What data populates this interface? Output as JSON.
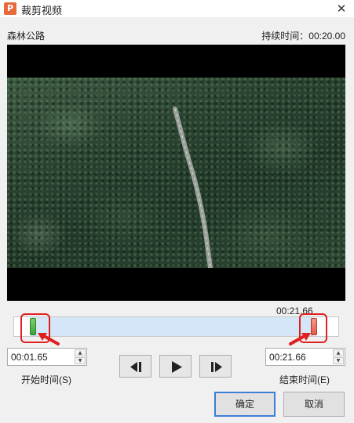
{
  "window": {
    "title": "裁剪视频",
    "app_icon_glyph": "P",
    "close_glyph": "✕"
  },
  "video": {
    "name": "森林公路",
    "duration_label": "持续时间：00:20.00"
  },
  "timeline": {
    "end_marker_time": "00:21.66",
    "start_handle_position": 0.06,
    "end_handle_position": 0.92
  },
  "start_time": {
    "value": "00:01.65",
    "label": "开始时间(S)"
  },
  "end_time": {
    "value": "00:21.66",
    "label": "结束时间(E)"
  },
  "spinner": {
    "up_glyph": "▲",
    "down_glyph": "▼"
  },
  "controls": {
    "prev_frame_icon": "step-back-icon",
    "play_icon": "play-icon",
    "next_frame_icon": "step-forward-icon"
  },
  "buttons": {
    "ok": "确定",
    "cancel": "取消"
  },
  "colors": {
    "start_handle": "#3da33a",
    "end_handle": "#e25a47",
    "selection": "#d5e6f8",
    "highlight": "#e02020",
    "primary_border": "#3c7fd6"
  }
}
